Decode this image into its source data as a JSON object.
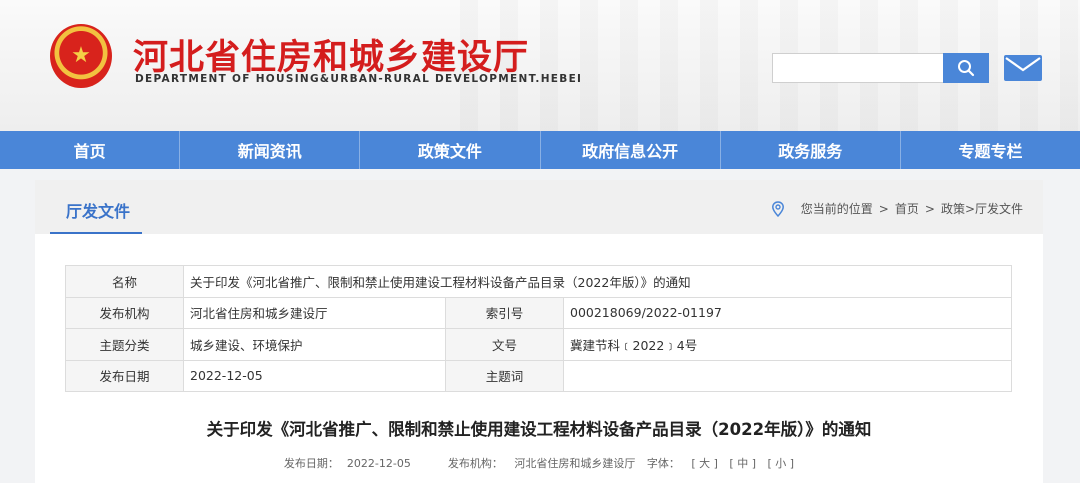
{
  "header": {
    "title": "河北省住房和城乡建设厅",
    "subtitle": "DEPARTMENT OF HOUSING&URBAN-RURAL DEVELOPMENT.HEBEI",
    "search": {
      "value": "",
      "placeholder": ""
    },
    "icons": {
      "emblem": "national-emblem",
      "search": "search-icon",
      "mail": "mail-icon"
    }
  },
  "nav": {
    "items": [
      {
        "label": "首页"
      },
      {
        "label": "新闻资讯"
      },
      {
        "label": "政策文件"
      },
      {
        "label": "政府信息公开"
      },
      {
        "label": "政务服务"
      },
      {
        "label": "专题专栏"
      }
    ]
  },
  "section": {
    "title": "厅发文件",
    "breadcrumb": {
      "prefix": "您当前的位置",
      "sep1": ">",
      "home": "首页",
      "sep2": ">",
      "path": "政策>厅发文件"
    }
  },
  "info": {
    "name_label": "名称",
    "name_value": "关于印发《河北省推广、限制和禁止使用建设工程材料设备产品目录（2022年版）》的通知",
    "publisher_label": "发布机构",
    "publisher_value": "河北省住房和城乡建设厅",
    "index_label": "索引号",
    "index_value": "000218069/2022-01197",
    "category_label": "主题分类",
    "category_value": "城乡建设、环境保护",
    "docno_label": "文号",
    "docno_value": "冀建节科﹝2022﹞4号",
    "date_label": "发布日期",
    "date_value": "2022-12-05",
    "keyword_label": "主题词",
    "keyword_value": ""
  },
  "document": {
    "title": "关于印发《河北省推广、限制和禁止使用建设工程材料设备产品目录（2022年版）》的通知",
    "date_label": "发布日期：",
    "date": "2022-12-05",
    "publisher_label": "发布机构：",
    "publisher": "河北省住房和城乡建设厅",
    "fontsize_label": "字体：",
    "font_large": "[ 大 ]",
    "font_medium": "[ 中 ]",
    "font_small": "[ 小 ]"
  },
  "colors": {
    "brand_red": "#d41d1d",
    "nav_blue": "#4a86d8",
    "link_blue": "#3a73c9"
  }
}
